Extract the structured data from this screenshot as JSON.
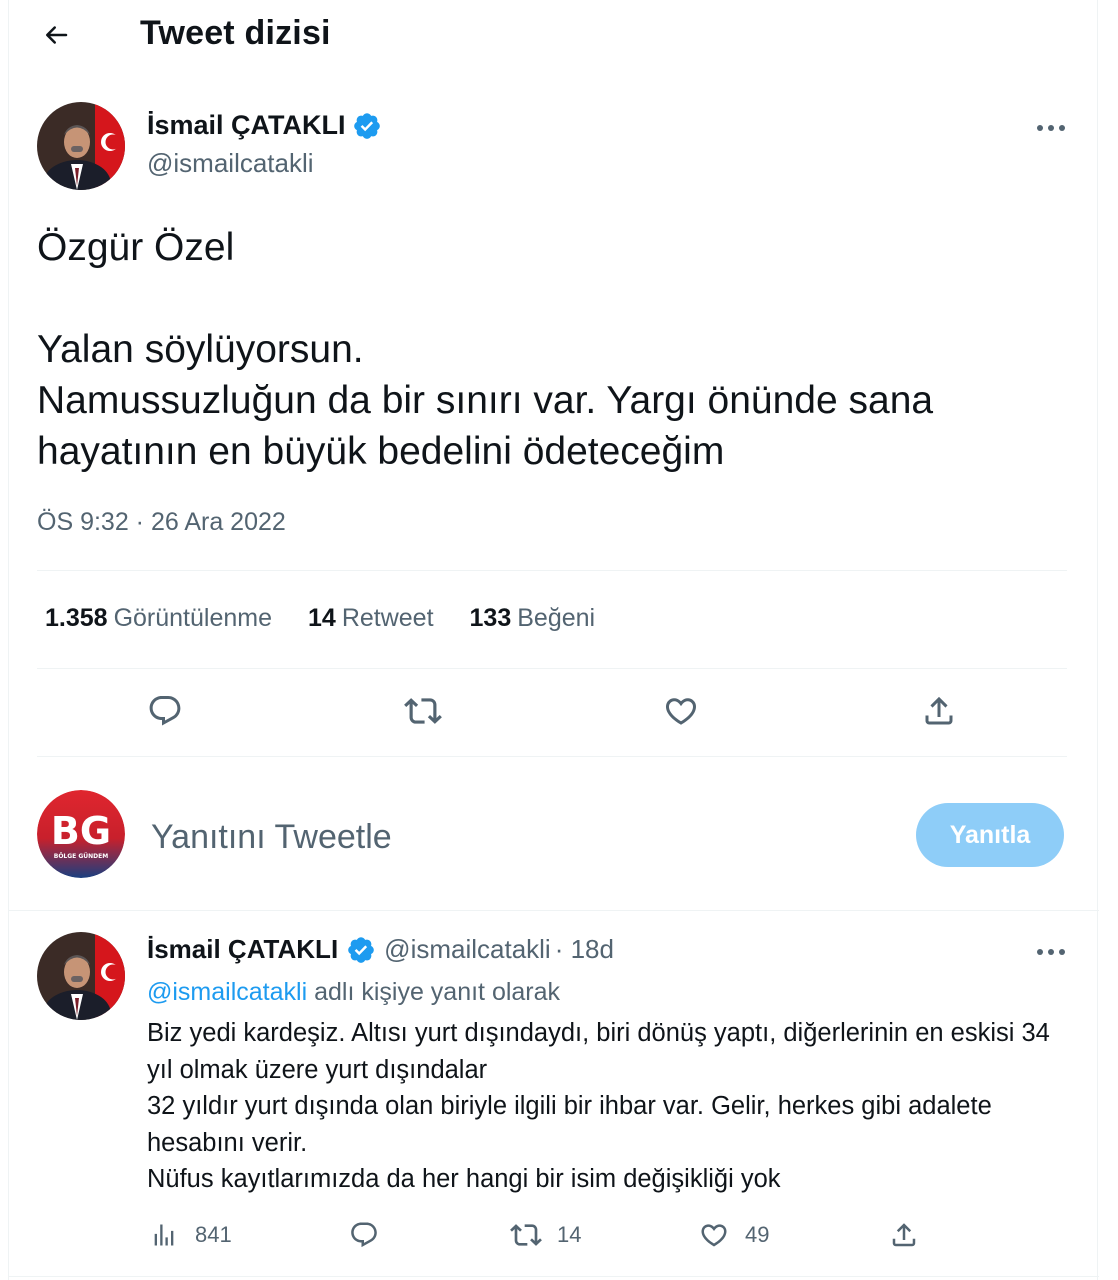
{
  "header": {
    "title": "Tweet dizisi"
  },
  "main_tweet": {
    "author_name": "İsmail ÇATAKLI",
    "author_handle": "@ismailcatakli",
    "text": "Özgür Özel\n\nYalan söylüyorsun.\nNamussuzluğun da bir sınırı var. Yargı önünde sana hayatının en büyük bedelini ödeteceğim",
    "timestamp": "ÖS 9:32 · 26 Ara 2022",
    "stats": {
      "views_count": "1.358",
      "views_label": "Görüntülenme",
      "retweets_count": "14",
      "retweets_label": "Retweet",
      "likes_count": "133",
      "likes_label": "Beğeni"
    }
  },
  "composer": {
    "placeholder": "Yanıtını Tweetle",
    "reply_button": "Yanıtla",
    "avatar_text": "BG",
    "avatar_subtext": "BÖLGE GÜNDEM"
  },
  "reply_tweet": {
    "author_name": "İsmail ÇATAKLI",
    "author_handle": "@ismailcatakli",
    "time": "· 18d",
    "replying_mention": "@ismailcatakli",
    "replying_suffix": " adlı kişiye yanıt olarak",
    "text": "Biz yedi kardeşiz. Altısı yurt dışındaydı, biri dönüş yaptı, diğerlerinin en eskisi 34 yıl olmak üzere yurt dışındalar\n32 yıldır yurt dışında olan biriyle ilgili bir ihbar var. Gelir, herkes gibi adalete hesabını verir.\nNüfus kayıtlarımızda da her hangi bir isim değişikliği yok",
    "views": "841",
    "replies": "",
    "retweets": "14",
    "likes": "49"
  },
  "colors": {
    "accent": "#1d9bf0",
    "reply_button_disabled": "#8ecdf8",
    "secondary_text": "#536471",
    "divider": "#eff3f4"
  },
  "icons": [
    "back-arrow-icon",
    "verified-badge-icon",
    "more-icon",
    "reply-icon",
    "retweet-icon",
    "like-icon",
    "share-icon",
    "views-icon"
  ]
}
